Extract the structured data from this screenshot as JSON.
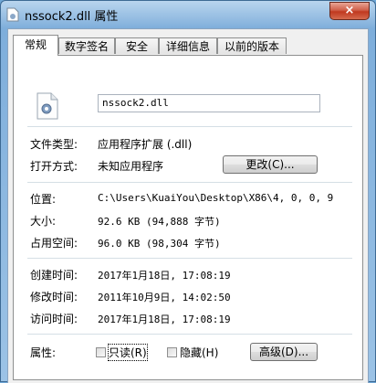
{
  "window": {
    "title": "nssock2.dll 属性",
    "close_glyph": "×"
  },
  "tabs": [
    {
      "label": "常规"
    },
    {
      "label": "数字签名"
    },
    {
      "label": "安全"
    },
    {
      "label": "详细信息"
    },
    {
      "label": "以前的版本"
    }
  ],
  "file": {
    "icon": "settings-file-icon",
    "name": "nssock2.dll"
  },
  "type": {
    "label": "文件类型:",
    "value": "应用程序扩展 (.dll)"
  },
  "opens_with": {
    "label": "打开方式:",
    "value": "未知应用程序",
    "change_button": "更改(C)..."
  },
  "location": {
    "label": "位置:",
    "value": "C:\\Users\\KuaiYou\\Desktop\\X86\\4, 0, 0, 9"
  },
  "size": {
    "label": "大小:",
    "value": "92.6 KB (94,888 字节)"
  },
  "size_on_disk": {
    "label": "占用空间:",
    "value": "96.0 KB (98,304 字节)"
  },
  "created": {
    "label": "创建时间:",
    "value": "2017年1月18日, 17:08:19"
  },
  "modified": {
    "label": "修改时间:",
    "value": "2011年10月9日, 14:02:50"
  },
  "accessed": {
    "label": "访问时间:",
    "value": "2017年1月18日, 17:08:19"
  },
  "attributes": {
    "label": "属性:",
    "readonly": "只读(R)",
    "hidden": "隐藏(H)",
    "advanced_button": "高级(D)..."
  },
  "colors": {
    "titlebar": "#8fb9e0",
    "close": "#c0381e",
    "panel": "#ffffff"
  }
}
